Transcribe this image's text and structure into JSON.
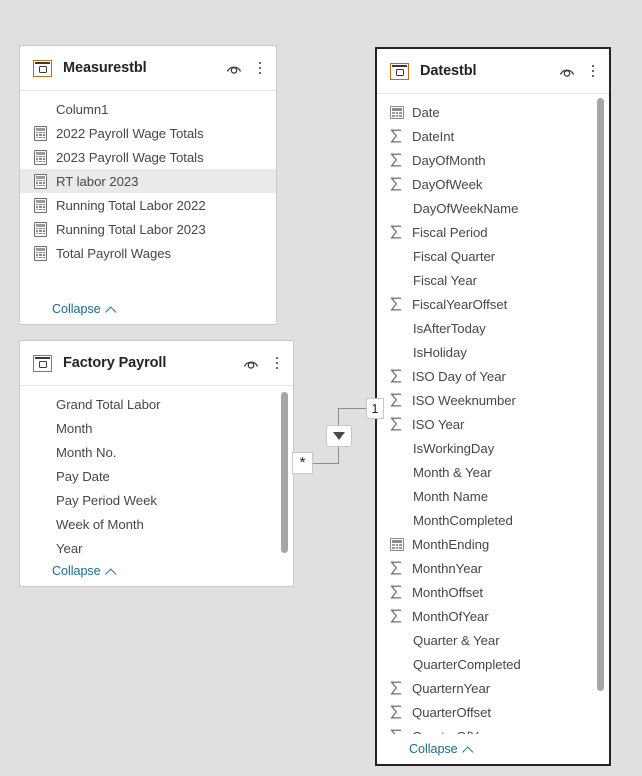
{
  "canvas": {
    "background_color": "#e1e0df"
  },
  "tables": [
    {
      "id": "measurestbl",
      "title": "Measurestbl",
      "selected": false,
      "header_icons": {
        "table_icon": "table-icon",
        "eye_icon": "hide-show-eye-icon",
        "more_icon": "more-options-icon"
      },
      "collapse_label": "Collapse",
      "has_scrollbar": false,
      "fields": [
        {
          "label": "Column1",
          "icon": "none",
          "selected": false
        },
        {
          "label": "2022 Payroll Wage Totals",
          "icon": "measure",
          "selected": false
        },
        {
          "label": "2023 Payroll Wage Totals",
          "icon": "measure",
          "selected": false
        },
        {
          "label": "RT labor 2023",
          "icon": "measure",
          "selected": true
        },
        {
          "label": "Running Total Labor 2022",
          "icon": "measure",
          "selected": false
        },
        {
          "label": "Running Total Labor 2023",
          "icon": "measure",
          "selected": false
        },
        {
          "label": "Total Payroll Wages",
          "icon": "measure",
          "selected": false
        }
      ]
    },
    {
      "id": "factory-payroll",
      "title": "Factory Payroll",
      "selected": false,
      "header_icons": {
        "table_icon": "table-icon",
        "eye_icon": "hide-show-eye-icon",
        "more_icon": "more-options-icon"
      },
      "collapse_label": "Collapse",
      "has_scrollbar": true,
      "fields": [
        {
          "label": "Grand Total Labor",
          "icon": "none",
          "selected": false
        },
        {
          "label": "Month",
          "icon": "none",
          "selected": false
        },
        {
          "label": "Month No.",
          "icon": "none",
          "selected": false
        },
        {
          "label": "Pay Date",
          "icon": "none",
          "selected": false
        },
        {
          "label": "Pay Period Week",
          "icon": "none",
          "selected": false
        },
        {
          "label": "Week of Month",
          "icon": "none",
          "selected": false
        },
        {
          "label": "Year",
          "icon": "none",
          "selected": false
        }
      ]
    },
    {
      "id": "datestbl",
      "title": "Datestbl",
      "selected": true,
      "header_icons": {
        "table_icon": "table-icon",
        "eye_icon": "hide-show-eye-icon",
        "more_icon": "more-options-icon"
      },
      "collapse_label": "Collapse",
      "has_scrollbar": true,
      "fields": [
        {
          "label": "Date",
          "icon": "calendar",
          "selected": false
        },
        {
          "label": "DateInt",
          "icon": "sigma",
          "selected": false
        },
        {
          "label": "DayOfMonth",
          "icon": "sigma",
          "selected": false
        },
        {
          "label": "DayOfWeek",
          "icon": "sigma",
          "selected": false
        },
        {
          "label": "DayOfWeekName",
          "icon": "none",
          "selected": false
        },
        {
          "label": "Fiscal Period",
          "icon": "sigma",
          "selected": false
        },
        {
          "label": "Fiscal Quarter",
          "icon": "none",
          "selected": false
        },
        {
          "label": "Fiscal Year",
          "icon": "none",
          "selected": false
        },
        {
          "label": "FiscalYearOffset",
          "icon": "sigma",
          "selected": false
        },
        {
          "label": "IsAfterToday",
          "icon": "none",
          "selected": false
        },
        {
          "label": "IsHoliday",
          "icon": "none",
          "selected": false
        },
        {
          "label": "ISO Day of Year",
          "icon": "sigma",
          "selected": false
        },
        {
          "label": "ISO Weeknumber",
          "icon": "sigma",
          "selected": false
        },
        {
          "label": "ISO Year",
          "icon": "sigma",
          "selected": false
        },
        {
          "label": "IsWorkingDay",
          "icon": "none",
          "selected": false
        },
        {
          "label": "Month & Year",
          "icon": "none",
          "selected": false
        },
        {
          "label": "Month Name",
          "icon": "none",
          "selected": false
        },
        {
          "label": "MonthCompleted",
          "icon": "none",
          "selected": false
        },
        {
          "label": "MonthEnding",
          "icon": "calendar",
          "selected": false
        },
        {
          "label": "MonthnYear",
          "icon": "sigma",
          "selected": false
        },
        {
          "label": "MonthOffset",
          "icon": "sigma",
          "selected": false
        },
        {
          "label": "MonthOfYear",
          "icon": "sigma",
          "selected": false
        },
        {
          "label": "Quarter & Year",
          "icon": "none",
          "selected": false
        },
        {
          "label": "QuarterCompleted",
          "icon": "none",
          "selected": false
        },
        {
          "label": "QuarternYear",
          "icon": "sigma",
          "selected": false
        },
        {
          "label": "QuarterOffset",
          "icon": "sigma",
          "selected": false
        },
        {
          "label": "QuarterOfYear",
          "icon": "sigma",
          "selected": false
        }
      ]
    }
  ],
  "relationship": {
    "many_cardinality": "*",
    "one_cardinality": "1",
    "cross_filter_direction_icon": "filter-direction-arrow-icon"
  }
}
